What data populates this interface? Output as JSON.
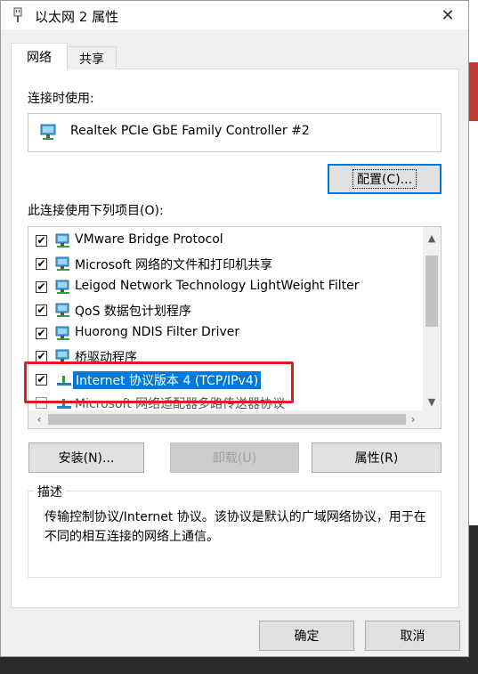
{
  "window": {
    "title": "以太网 2 属性",
    "close_glyph": "✕"
  },
  "tabs": [
    {
      "label": "网络",
      "active": true
    },
    {
      "label": "共享",
      "active": false
    }
  ],
  "connect_using": {
    "label": "连接时使用:",
    "adapter": "Realtek PCIe GbE Family Controller #2",
    "configure_button": "配置(C)..."
  },
  "items_section": {
    "label": "此连接使用下列项目(O):",
    "items": [
      {
        "label": "VMware Bridge Protocol",
        "checked": true,
        "icon": "network-client-icon"
      },
      {
        "label": "Microsoft 网络的文件和打印机共享",
        "checked": true,
        "icon": "network-client-icon"
      },
      {
        "label": "Leigod Network Technology LightWeight Filter",
        "checked": true,
        "icon": "network-client-icon"
      },
      {
        "label": "QoS 数据包计划程序",
        "checked": true,
        "icon": "network-client-icon"
      },
      {
        "label": "Huorong NDIS Filter Driver",
        "checked": true,
        "icon": "network-client-icon"
      },
      {
        "label": "桥驱动程序",
        "checked": true,
        "icon": "network-client-icon"
      },
      {
        "label": "Internet 协议版本 4 (TCP/IPv4)",
        "checked": true,
        "icon": "protocol-icon",
        "selected": true
      },
      {
        "label": "Microsoft 网络适配器多路传送器协议",
        "checked": false,
        "icon": "protocol-icon"
      }
    ]
  },
  "buttons": {
    "install": "安装(N)...",
    "uninstall": "卸载(U)",
    "properties": "属性(R)",
    "ok": "确定",
    "cancel": "取消"
  },
  "description": {
    "title": "描述",
    "text": "传输控制协议/Internet 协议。该协议是默认的广域网络协议，用于在不同的相互连接的网络上通信。"
  },
  "colors": {
    "selection": "#0078d7",
    "highlight_border": "#e21b1b"
  }
}
